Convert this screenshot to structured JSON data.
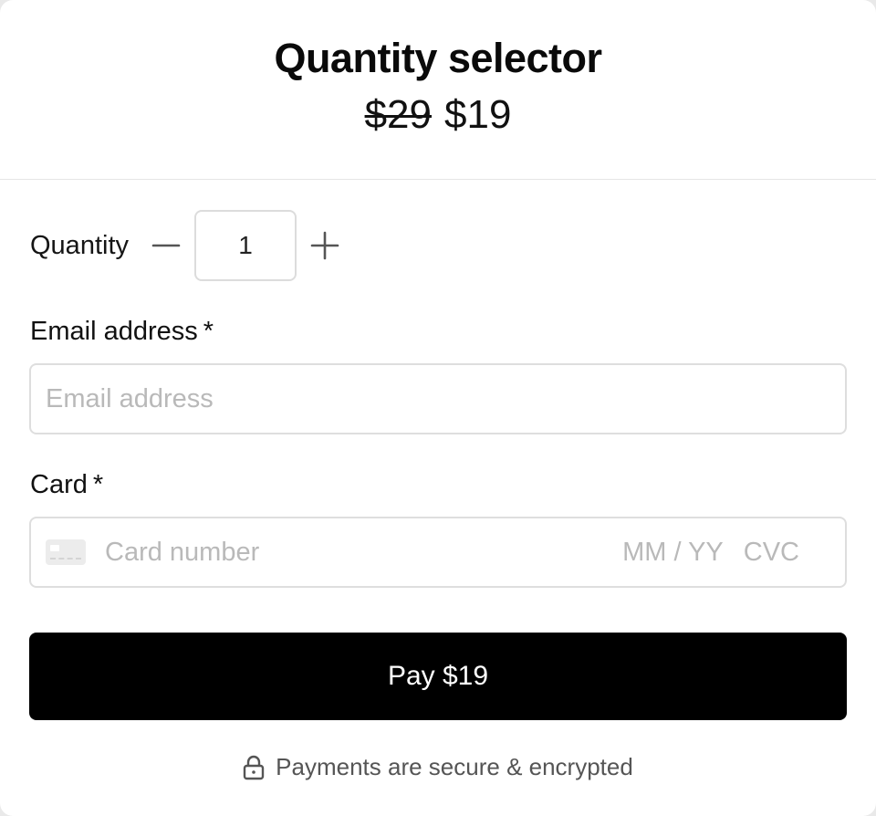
{
  "header": {
    "title": "Quantity selector",
    "old_price": "$29",
    "new_price": "$19"
  },
  "quantity": {
    "label": "Quantity",
    "value": "1",
    "decrement_icon": "minus-icon",
    "increment_icon": "plus-icon"
  },
  "email": {
    "label": "Email address",
    "required_mark": "*",
    "placeholder": "Email address"
  },
  "card": {
    "label": "Card",
    "required_mark": "*",
    "number_placeholder": "Card number",
    "expiry_placeholder": "MM / YY",
    "cvc_placeholder": "CVC",
    "icon": "credit-card-icon"
  },
  "pay_button": {
    "label": "Pay $19",
    "color": "#000000"
  },
  "footer": {
    "secure_text": "Payments are secure & encrypted",
    "icon": "lock-icon"
  }
}
